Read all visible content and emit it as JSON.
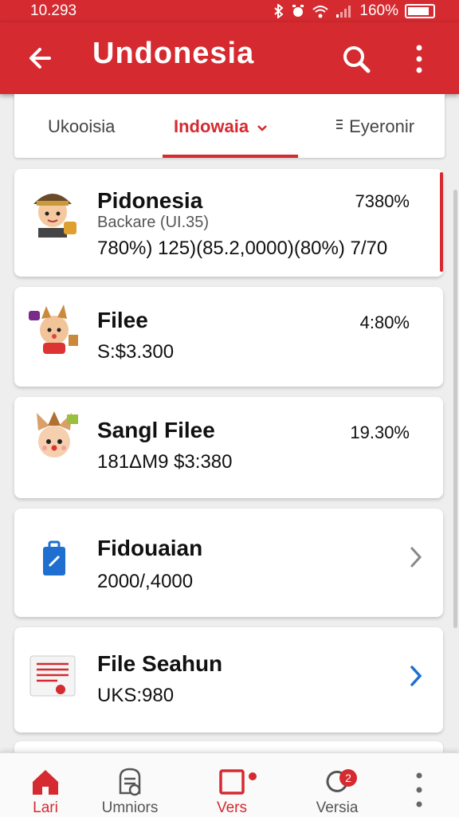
{
  "status": {
    "time": "10.293",
    "battery": "160%"
  },
  "appbar": {
    "title": "Undonesia"
  },
  "tabs": [
    {
      "label": "Ukooisia"
    },
    {
      "label": "Indowaia"
    },
    {
      "label": "Eyeronir"
    }
  ],
  "list": [
    {
      "name": "Pidonesia",
      "percent": "7380%",
      "subtitle": "Backare (UI.35)",
      "detail": "780%) 125)(85.2,0000)(80%) 7/70"
    },
    {
      "name": "Filee",
      "percent": "4:80%",
      "detail": "S:$3.300"
    },
    {
      "name": "Sangl Filee",
      "percent": "19.30%",
      "detail": "181ΔM9  $3:380"
    },
    {
      "name": "Fidouaian",
      "detail": "2000/,4000"
    },
    {
      "name": "File Seahun",
      "detail": "UKS:980"
    }
  ],
  "bottom_nav": [
    {
      "label": "Lari"
    },
    {
      "label": "Umniors"
    },
    {
      "label": "Vers"
    },
    {
      "label": "Versia",
      "badge": "2"
    }
  ],
  "colors": {
    "accent": "#d42a30",
    "chevron_blue": "#1e6fd0"
  }
}
